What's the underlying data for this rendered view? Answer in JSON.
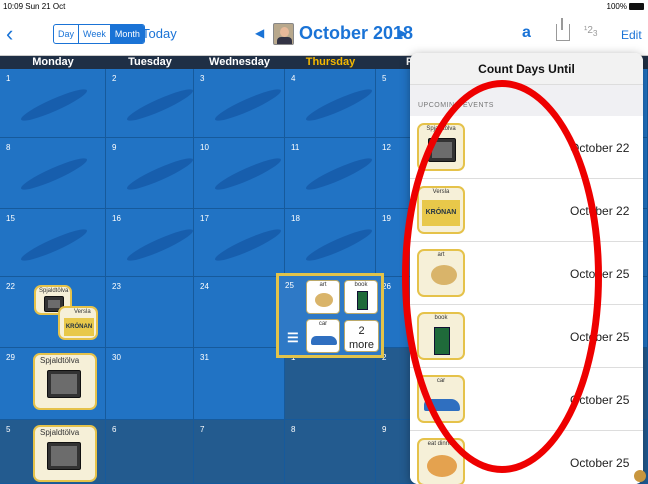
{
  "status": {
    "time": "10:09",
    "date": "Sun 21 Oct",
    "battery": "100%"
  },
  "toolbar": {
    "views": [
      "Day",
      "Week",
      "Month"
    ],
    "active_view": "Month",
    "today_label": "Today",
    "month_title": "October 2018",
    "edit_label": "Edit",
    "count_icon_label": "123"
  },
  "days": [
    "Monday",
    "Tuesday",
    "Wednesday",
    "Thursday",
    "F"
  ],
  "weeks": [
    [
      "1",
      "2",
      "3",
      "4",
      "5"
    ],
    [
      "8",
      "9",
      "10",
      "11",
      "12"
    ],
    [
      "15",
      "16",
      "17",
      "18",
      "19"
    ],
    [
      "22",
      "23",
      "24",
      "25",
      "26"
    ],
    [
      "29",
      "30",
      "31",
      "1",
      "2"
    ],
    [
      "5",
      "6",
      "7",
      "8",
      "9"
    ]
  ],
  "events": {
    "day22_a": "Spjaldtölva",
    "day22_b": "Versla",
    "day22_b_text": "KRÓNAN",
    "day29": "Spjaldtölva",
    "week6_mon": "Spjaldtölva",
    "day25": {
      "art": "art",
      "book": "book",
      "car": "car",
      "more": "2\nmore"
    }
  },
  "popover": {
    "title": "Count Days Until",
    "section": "UPCOMING EVENTS",
    "rows": [
      {
        "label": "Spjaldtölva",
        "date": "October 22"
      },
      {
        "label": "Versla",
        "date": "October 22"
      },
      {
        "label": "art",
        "date": "October 25"
      },
      {
        "label": "book",
        "date": "October 25"
      },
      {
        "label": "car",
        "date": "October 25"
      },
      {
        "label": "eat dinner",
        "date": "October 25"
      }
    ]
  },
  "colors": {
    "accent": "#1a73d6",
    "thursday": "#f5b800",
    "annotation": "#e00000"
  }
}
